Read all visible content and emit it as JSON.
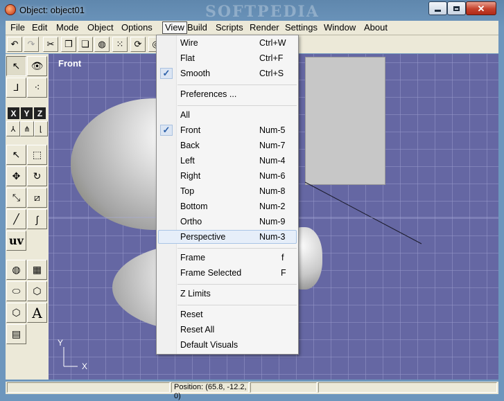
{
  "window": {
    "title": "Object: object01",
    "watermark": "SOFTPEDIA"
  },
  "menubar": [
    "File",
    "Edit",
    "Mode",
    "Object",
    "Options",
    "View",
    "Build",
    "Scripts",
    "Render",
    "Settings",
    "Window",
    "About"
  ],
  "view_menu": {
    "items": [
      {
        "label": "Wire",
        "accel": "Ctrl+W",
        "checked": false
      },
      {
        "label": "Flat",
        "accel": "Ctrl+F",
        "checked": false
      },
      {
        "label": "Smooth",
        "accel": "Ctrl+S",
        "checked": true
      },
      {
        "label": "Preferences ...",
        "accel": "",
        "checked": false
      },
      {
        "label": "All",
        "accel": "",
        "checked": false
      },
      {
        "label": "Front",
        "accel": "Num-5",
        "checked": true
      },
      {
        "label": "Back",
        "accel": "Num-7",
        "checked": false
      },
      {
        "label": "Left",
        "accel": "Num-4",
        "checked": false
      },
      {
        "label": "Right",
        "accel": "Num-6",
        "checked": false
      },
      {
        "label": "Top",
        "accel": "Num-8",
        "checked": false
      },
      {
        "label": "Bottom",
        "accel": "Num-2",
        "checked": false
      },
      {
        "label": "Ortho",
        "accel": "Num-9",
        "checked": false
      },
      {
        "label": "Perspective",
        "accel": "Num-3",
        "checked": false,
        "highlighted": true
      },
      {
        "label": "Frame",
        "accel": "f",
        "checked": false
      },
      {
        "label": "Frame Selected",
        "accel": "F",
        "checked": false
      },
      {
        "label": "Z Limits",
        "accel": "",
        "checked": false
      },
      {
        "label": "Reset",
        "accel": "",
        "checked": false
      },
      {
        "label": "Reset All",
        "accel": "",
        "checked": false
      },
      {
        "label": "Default Visuals",
        "accel": "",
        "checked": false
      }
    ],
    "check_mark": "✓"
  },
  "viewport": {
    "label": "Front",
    "axis_y": "Y",
    "axis_x": "X"
  },
  "toolbox": {
    "axis_x": "X",
    "axis_y": "Y",
    "axis_z": "Z",
    "uv_label": "uv",
    "text_label": "A"
  },
  "status": {
    "position": "Position: (65.8, -12.2, 0)"
  },
  "colors": {
    "viewport_bg": "#6567a3",
    "grid": "#9698c8",
    "menu_bg": "#f5f5f5",
    "highlight": "#e6eef9",
    "window_frame": "#6d96bd"
  }
}
